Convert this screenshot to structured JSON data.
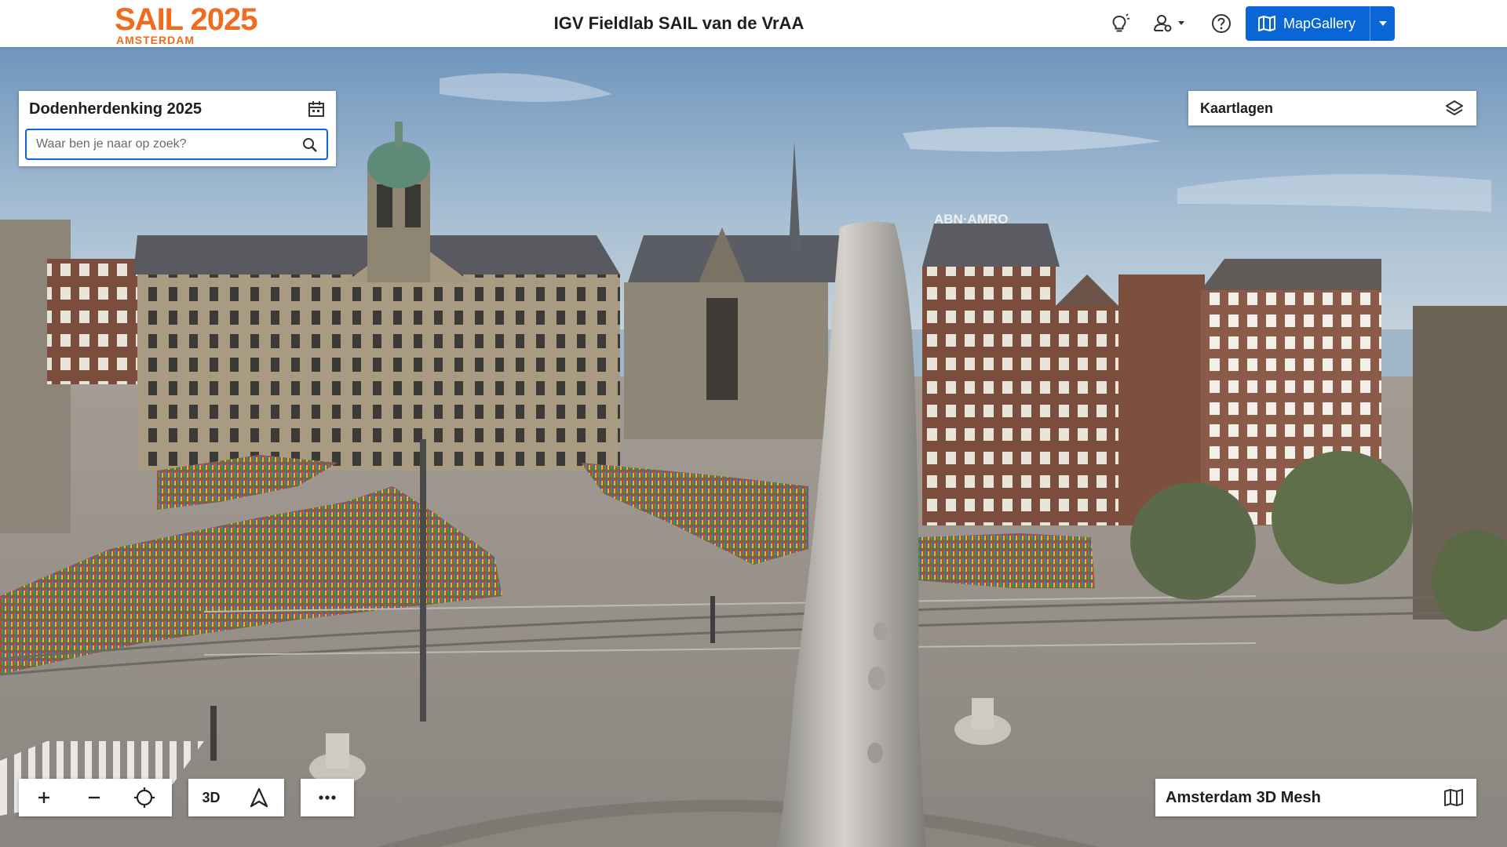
{
  "header": {
    "logo_main": "SAIL 2025",
    "logo_sub": "AMSTERDAM",
    "title": "IGV Fieldlab SAIL van de VrAA",
    "icons": [
      "lightbulb-icon",
      "user-settings-icon",
      "help-icon"
    ],
    "mapgallery_label": "MapGallery"
  },
  "search_panel": {
    "title": "Dodenherdenking 2025",
    "placeholder": "Waar ben je naar op zoek?",
    "value": ""
  },
  "layers_panel": {
    "title": "Kaartlagen"
  },
  "basemap_panel": {
    "title": "Amsterdam 3D Mesh"
  },
  "toolbar": {
    "zoom_in": "+",
    "zoom_out": "−",
    "mode_3d": "3D",
    "more": "•••"
  },
  "scene_text": {
    "bank_sign": "ABN·AMRO"
  },
  "colors": {
    "brand_orange": "#f26b1d",
    "accent_blue": "#0a66d6",
    "panel_bg": "#ffffff",
    "text_dark": "#1e1e1e"
  }
}
